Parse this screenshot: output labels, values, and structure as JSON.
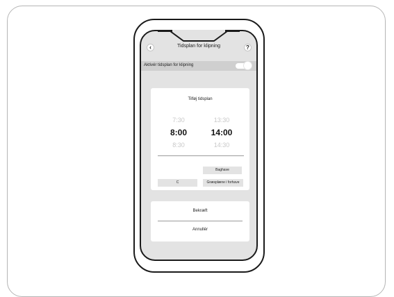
{
  "header": {
    "title": "Tidsplan for klipning",
    "back_icon": "chevron-left-icon",
    "back_glyph": "‹",
    "help_icon": "help-icon",
    "help_glyph": "?"
  },
  "toggle_row": {
    "label": "Aktivér tidsplan for klipning",
    "enabled": true
  },
  "schedule_card": {
    "title": "Tilføj tidsplan",
    "start_times": [
      "7:30",
      "8:00",
      "8:30"
    ],
    "end_times": [
      "13:30",
      "14:00",
      "14:30"
    ],
    "selected_start": "8:00",
    "selected_end": "14:00"
  },
  "zones": {
    "baghave": "Baghave",
    "c": "C",
    "grass": "Græsplæne i forhave"
  },
  "actions": {
    "confirm": "Bekræft",
    "cancel": "Annullér"
  },
  "colors": {
    "screen_bg": "#e3e3e3",
    "toggle_row_bg": "#cfcfcf",
    "card_bg": "#ffffff",
    "outline": "#1a1a1a"
  }
}
